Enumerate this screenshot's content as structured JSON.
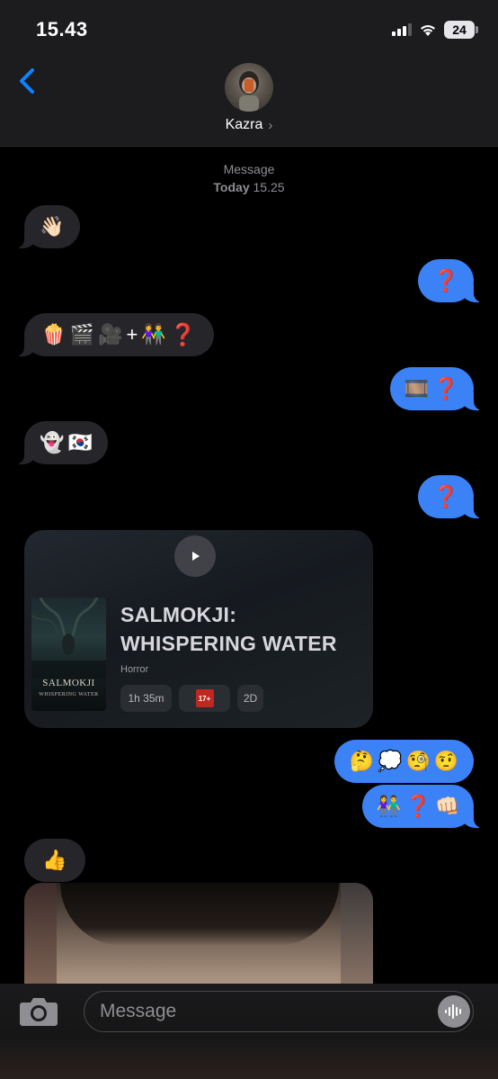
{
  "status_bar": {
    "time": "15.43",
    "battery_level": "24"
  },
  "header": {
    "contact_name": "Kazra",
    "chevron": "›",
    "back_icon": "chevron-left-icon"
  },
  "thread": {
    "timestamp_label": "Message",
    "timestamp_day": "Today",
    "timestamp_time": "15.25",
    "messages": [
      {
        "direction": "in",
        "emoji": [
          "👋🏻"
        ]
      },
      {
        "direction": "out",
        "emoji": [
          "❓"
        ]
      },
      {
        "direction": "in",
        "emoji": [
          "🍿",
          "🎬",
          "🎥",
          "+",
          "👫",
          "❓"
        ]
      },
      {
        "direction": "out",
        "emoji": [
          "🎞️",
          "❓"
        ]
      },
      {
        "direction": "in",
        "emoji": [
          "👻",
          "🇰🇷"
        ]
      },
      {
        "direction": "out",
        "emoji": [
          "❓"
        ]
      },
      {
        "direction": "out",
        "emoji": [
          "🤔",
          "💭",
          "🧐",
          "🤨"
        ]
      },
      {
        "direction": "out",
        "emoji": [
          "👫",
          "❓",
          "👊🏻"
        ]
      },
      {
        "direction": "in",
        "emoji": [
          "👍"
        ]
      }
    ],
    "movie_card": {
      "poster_title": "SALMOKJI",
      "poster_subtitle": "WHISPERING WATER",
      "title": "SALMOKJI: WHISPERING WATER",
      "genre": "Horror",
      "duration": "1h 35m",
      "rating": "17+",
      "format": "2D"
    }
  },
  "composer": {
    "placeholder": "Message"
  },
  "colors": {
    "incoming_bubble": "#26252a",
    "outgoing_bubble": "#3b82f6",
    "accent": "#0a84ff"
  }
}
